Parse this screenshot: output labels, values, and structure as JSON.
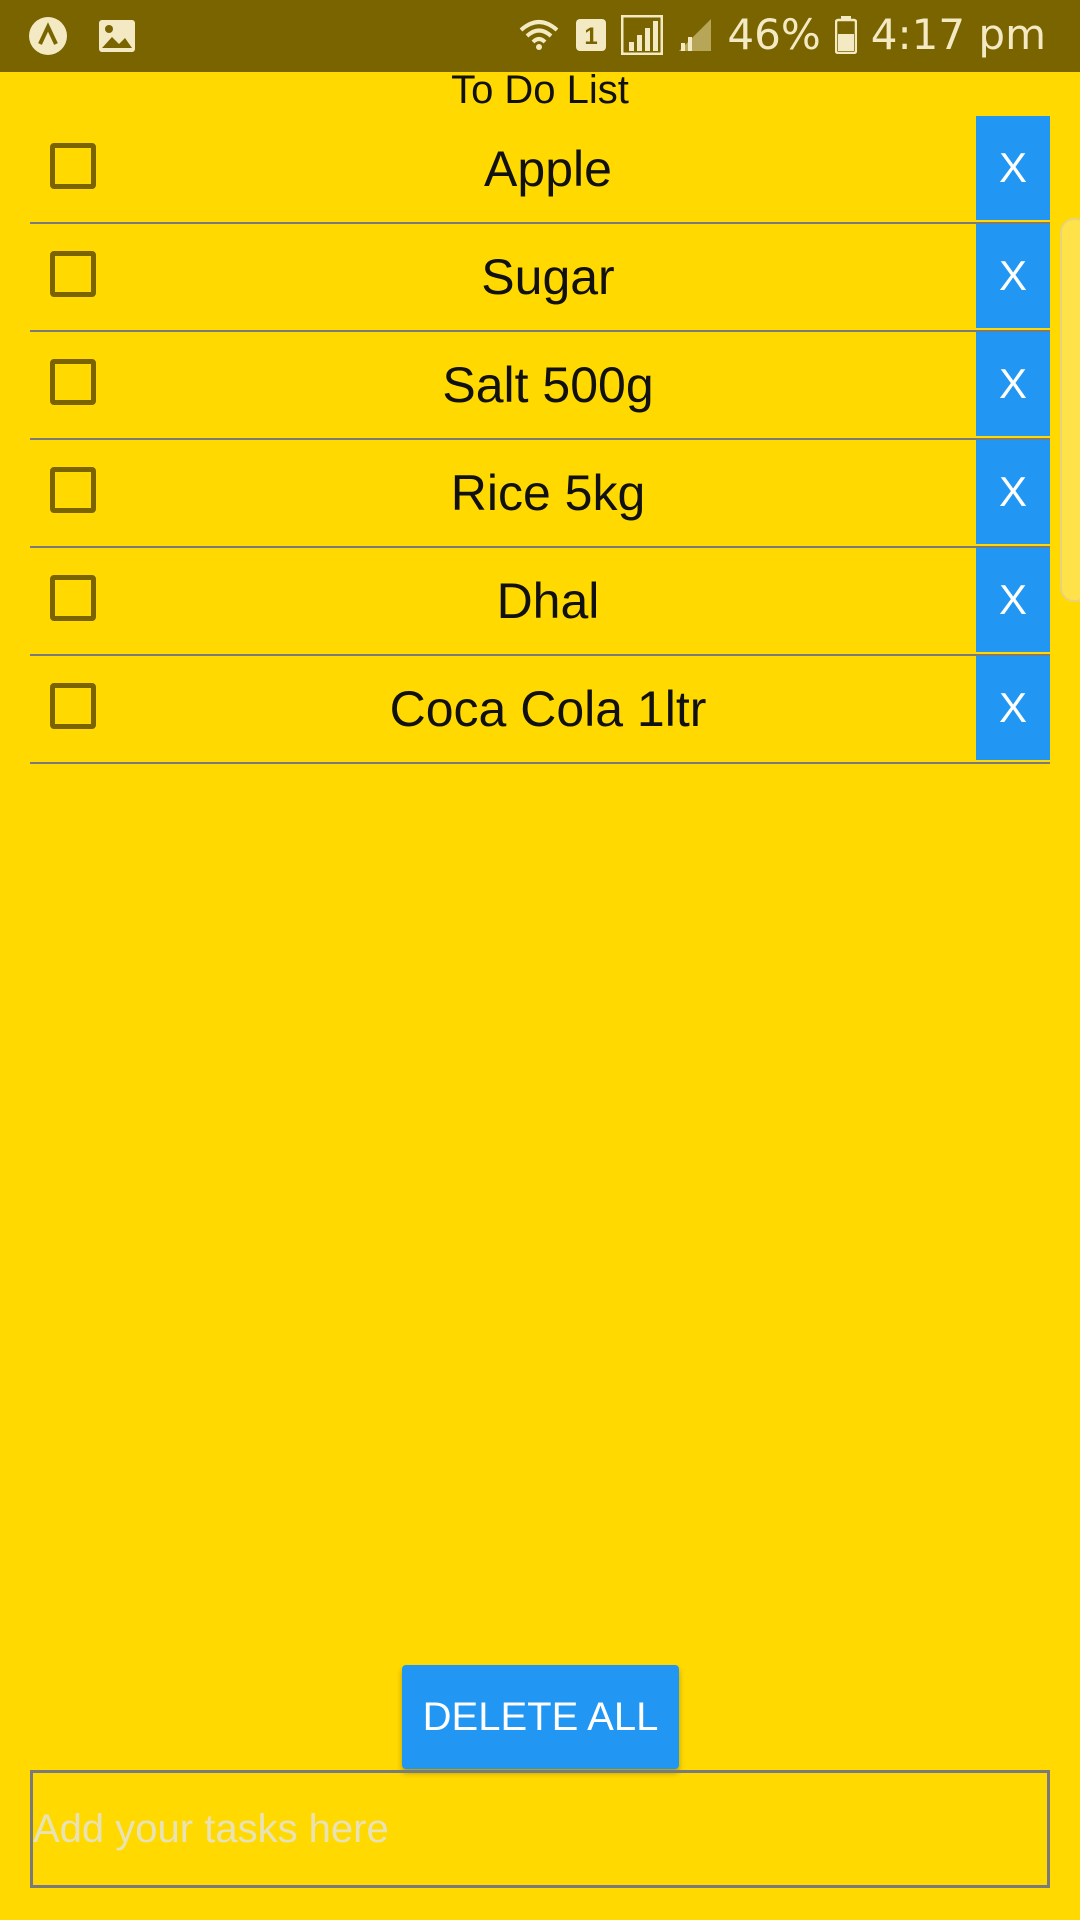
{
  "status_bar": {
    "battery": "46%",
    "time": "4:17 pm",
    "sim_badge": "1",
    "icons": [
      "app-logo-icon",
      "image-icon",
      "wifi-icon",
      "sim-icon",
      "signal-icon",
      "signal-weak-icon",
      "battery-icon"
    ]
  },
  "title": "To Do List",
  "items": [
    {
      "text": "Apple",
      "delete_label": "X",
      "checked": false
    },
    {
      "text": "Sugar",
      "delete_label": "X",
      "checked": false
    },
    {
      "text": "Salt 500g",
      "delete_label": "X",
      "checked": false
    },
    {
      "text": "Rice 5kg",
      "delete_label": "X",
      "checked": false
    },
    {
      "text": "Dhal",
      "delete_label": "X",
      "checked": false
    },
    {
      "text": "Coca Cola 1ltr",
      "delete_label": "X",
      "checked": false
    }
  ],
  "delete_all_label": "DELETE ALL",
  "input": {
    "placeholder": "Add your tasks here",
    "value": ""
  },
  "colors": {
    "background": "#FFD900",
    "status_bar": "#7A6400",
    "button": "#2196F3"
  }
}
